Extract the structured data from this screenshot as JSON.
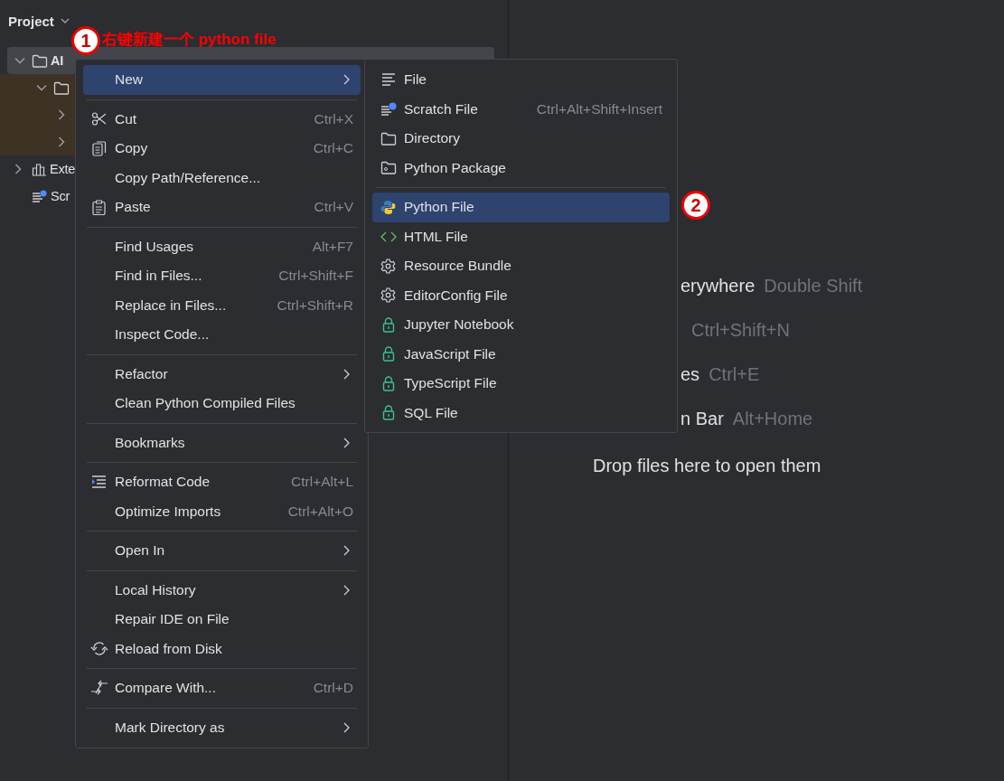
{
  "project_panel": {
    "title": "Project",
    "tree": [
      {
        "label": "AI",
        "kind": "folder",
        "expanded": true,
        "selected": true,
        "children": [
          {
            "kind": "folder",
            "expanded": true,
            "highlighted": true,
            "children": [
              {
                "expanded": false
              },
              {
                "expanded": false
              }
            ]
          }
        ]
      },
      {
        "label": "Exte",
        "kind": "library",
        "expanded": false
      },
      {
        "label": "Scr",
        "kind": "scratches"
      }
    ]
  },
  "editor": {
    "hints": [
      {
        "label": "erywhere",
        "shortcut": "Double Shift"
      },
      {
        "shortcut": "Ctrl+Shift+N"
      },
      {
        "label": "es",
        "shortcut": "Ctrl+E"
      },
      {
        "label": "n Bar",
        "shortcut": "Alt+Home"
      }
    ],
    "drop_text": "Drop files here to open them"
  },
  "context_menu": {
    "groups": [
      [
        {
          "label": "New",
          "submenu": true,
          "selected": true
        }
      ],
      [
        {
          "label": "Cut",
          "kind": "cut",
          "shortcut": "Ctrl+X",
          "submenu": false,
          "selected": false
        },
        {
          "label": "Copy",
          "kind": "copy",
          "shortcut": "Ctrl+C",
          "submenu": false,
          "selected": false
        },
        {
          "label": "Copy Path/Reference...",
          "submenu": false,
          "selected": false
        },
        {
          "label": "Paste",
          "kind": "paste",
          "shortcut": "Ctrl+V",
          "submenu": false,
          "selected": false
        }
      ],
      [
        {
          "label": "Find Usages",
          "shortcut": "Alt+F7",
          "submenu": false,
          "selected": false
        },
        {
          "label": "Find in Files...",
          "shortcut": "Ctrl+Shift+F",
          "submenu": false,
          "selected": false
        },
        {
          "label": "Replace in Files...",
          "shortcut": "Ctrl+Shift+R",
          "submenu": false,
          "selected": false
        },
        {
          "label": "Inspect Code...",
          "submenu": false,
          "selected": false
        }
      ],
      [
        {
          "label": "Refactor",
          "submenu": true,
          "selected": false
        },
        {
          "label": "Clean Python Compiled Files",
          "submenu": false,
          "selected": false
        }
      ],
      [
        {
          "label": "Bookmarks",
          "submenu": true,
          "selected": false
        }
      ],
      [
        {
          "label": "Reformat Code",
          "kind": "reformat",
          "shortcut": "Ctrl+Alt+L",
          "submenu": false,
          "selected": false
        },
        {
          "label": "Optimize Imports",
          "shortcut": "Ctrl+Alt+O",
          "submenu": false,
          "selected": false
        }
      ],
      [
        {
          "label": "Open In",
          "submenu": true,
          "selected": false
        }
      ],
      [
        {
          "label": "Local History",
          "submenu": true,
          "selected": false
        },
        {
          "label": "Repair IDE on File",
          "submenu": false,
          "selected": false
        },
        {
          "label": "Reload from Disk",
          "kind": "reload",
          "submenu": false,
          "selected": false
        }
      ],
      [
        {
          "label": "Compare With...",
          "kind": "compare",
          "shortcut": "Ctrl+D",
          "submenu": false,
          "selected": false
        }
      ],
      [
        {
          "label": "Mark Directory as",
          "submenu": true,
          "selected": false
        }
      ]
    ]
  },
  "new_submenu": {
    "groups": [
      [
        {
          "label": "File",
          "kind": "text-file",
          "selected": false
        },
        {
          "label": "Scratch File",
          "kind": "scratch",
          "shortcut": "Ctrl+Alt+Shift+Insert",
          "selected": false
        },
        {
          "label": "Directory",
          "kind": "folder",
          "selected": false
        },
        {
          "label": "Python Package",
          "kind": "package",
          "selected": false
        }
      ],
      [
        {
          "label": "Python File",
          "kind": "python",
          "selected": true
        },
        {
          "label": "HTML File",
          "kind": "html",
          "selected": false
        },
        {
          "label": "Resource Bundle",
          "kind": "gear",
          "selected": false
        },
        {
          "label": "EditorConfig File",
          "kind": "gear",
          "selected": false
        },
        {
          "label": "Jupyter Notebook",
          "kind": "lock",
          "selected": false
        },
        {
          "label": "JavaScript File",
          "kind": "lock",
          "selected": false
        },
        {
          "label": "TypeScript File",
          "kind": "lock",
          "selected": false
        },
        {
          "label": "SQL File",
          "kind": "lock",
          "selected": false
        }
      ]
    ]
  },
  "annotations": [
    {
      "number": "1",
      "text": "右键新建一个 python file"
    },
    {
      "number": "2"
    }
  ]
}
